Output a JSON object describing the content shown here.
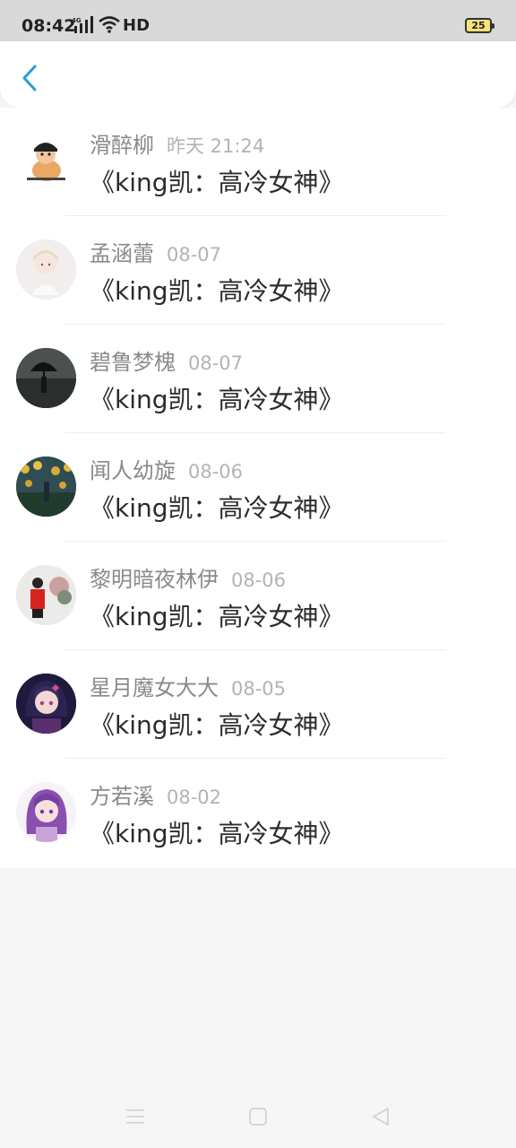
{
  "status_bar": {
    "time": "08:42",
    "network": "4G",
    "hd": "HD",
    "battery": "25"
  },
  "header": {
    "back_icon": "chevron-left-icon",
    "accent": "#2a9ad8"
  },
  "comments": [
    {
      "name": "滑醉柳",
      "time": "昨天 21:24",
      "message": "《king凯：高冷女神》"
    },
    {
      "name": "孟涵蕾",
      "time": "08-07",
      "message": "《king凯：高冷女神》"
    },
    {
      "name": "碧鲁梦槐",
      "time": "08-07",
      "message": "《king凯：高冷女神》"
    },
    {
      "name": "闻人幼旋",
      "time": "08-06",
      "message": "《king凯：高冷女神》"
    },
    {
      "name": "黎明暗夜林伊",
      "time": "08-06",
      "message": "《king凯：高冷女神》"
    },
    {
      "name": "星月魔女大大",
      "time": "08-05",
      "message": "《king凯：高冷女神》"
    },
    {
      "name": "方若溪",
      "time": "08-02",
      "message": "《king凯：高冷女神》"
    }
  ],
  "nav_bar": {
    "menu_icon": "menu-icon",
    "home_icon": "home-square-icon",
    "back_icon": "back-triangle-icon"
  }
}
